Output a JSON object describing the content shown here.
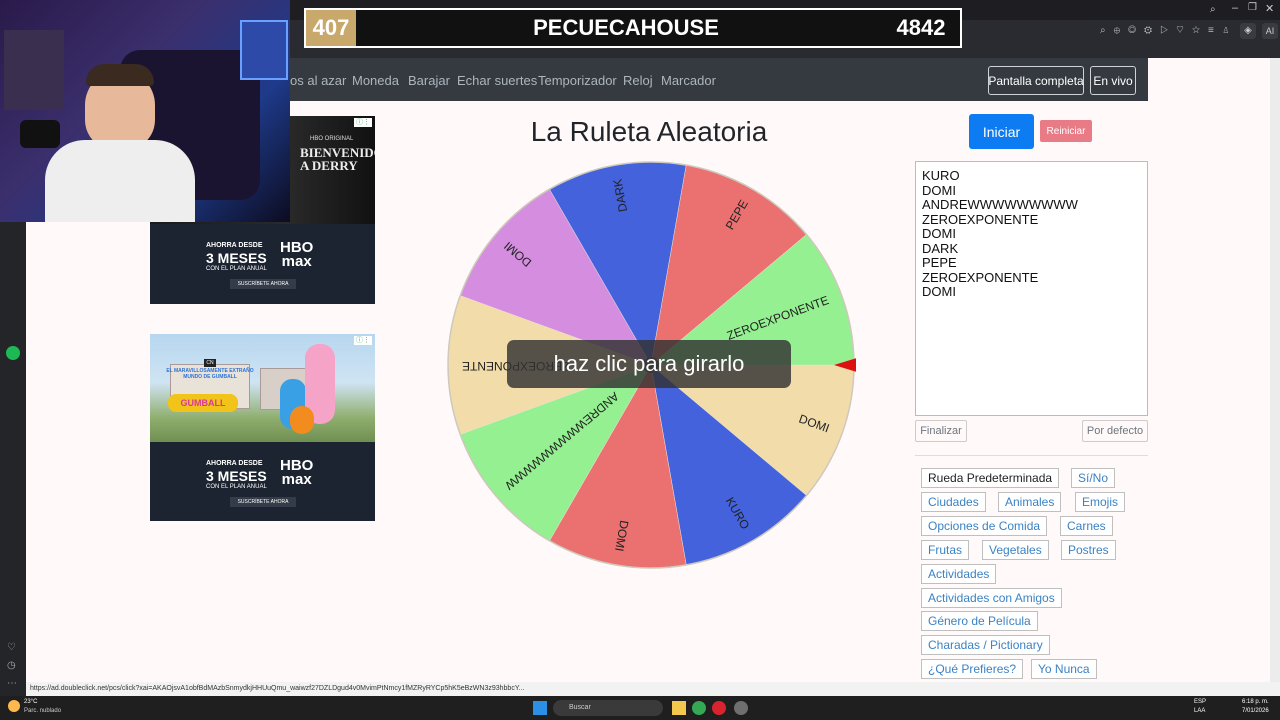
{
  "browser": {
    "status_url": "https://ad.doubleclick.net/pcs/click?xai=AKAOjsvA1obfBdMAzbSnmydkjHHUuQmu_waiwzf27DZLDgud4v0MvimPtNmcy1fMZRyRYCp5hK5eBzWN3z93hbbcY..."
  },
  "scoreboard": {
    "left": "407",
    "name": "PECUECAHOUSE",
    "right": "4842"
  },
  "nav": {
    "links": [
      "os al azar",
      "Moneda",
      "Barajar",
      "Echar suertes",
      "Temporizador",
      "Reloj",
      "Marcador"
    ],
    "fullscreen": "Pantalla completa",
    "live": "En vivo"
  },
  "main": {
    "title": "La Ruleta Aleatoria",
    "start": "Iniciar",
    "reset": "Reiniciar",
    "overlay": "haz clic para girarlo",
    "names": [
      "KURO",
      "DOMI",
      "ANDREWWWWWWWWW",
      "ZEROEXPONENTE",
      "DOMI",
      "DARK",
      "PEPE",
      "ZEROEXPONENTE",
      "DOMI"
    ],
    "finish": "Finalizar",
    "default": "Por defecto"
  },
  "wheel": {
    "segments": [
      {
        "label": "DOMI",
        "color": "#f1dcaa"
      },
      {
        "label": "KURO",
        "color": "#4462dc"
      },
      {
        "label": "DOMI",
        "color": "#eb7070"
      },
      {
        "label": "ANDREWWWWWWWWW",
        "color": "#94f090"
      },
      {
        "label": "ZEROEXPONENTE",
        "color": "#f1dcaa"
      },
      {
        "label": "DOMI",
        "color": "#d48ddf"
      },
      {
        "label": "DARK",
        "color": "#4462dc"
      },
      {
        "label": "PEPE",
        "color": "#eb7070"
      },
      {
        "label": "ZEROEXPONENTE",
        "color": "#94f090"
      }
    ],
    "pointer_color": "#dd1010"
  },
  "presets": [
    {
      "label": "Rueda Predeterminada"
    },
    {
      "label": "Sí/No"
    },
    {
      "label": "Ciudades"
    },
    {
      "label": "Animales"
    },
    {
      "label": "Emojis"
    },
    {
      "label": "Opciones de Comida"
    },
    {
      "label": "Carnes"
    },
    {
      "label": "Frutas"
    },
    {
      "label": "Vegetales"
    },
    {
      "label": "Postres"
    },
    {
      "label": "Actividades"
    },
    {
      "label": "Actividades con Amigos"
    },
    {
      "label": "Género de Película"
    },
    {
      "label": "Charadas / Pictionary"
    },
    {
      "label": "¿Qué Prefieres?"
    },
    {
      "label": "Yo Nunca"
    }
  ],
  "ads": {
    "ad1": {
      "brand": "HBO ORIGINAL",
      "headline": "BIENVENIDOS A DERRY",
      "offer_small": "AHORRA DESDE",
      "offer_big": "3 MESES",
      "offer_plan": "CON EL PLAN ANUAL",
      "logo_top": "HBO",
      "logo_bottom": "max",
      "cta": "SUSCRÍBETE AHORA"
    },
    "ad2": {
      "brand": "CN",
      "headline": "EL MARAVILLOSAMENTE EXTRAÑO MUNDO DE GUMBALL",
      "offer_small": "AHORRA DESDE",
      "offer_big": "3 MESES",
      "offer_plan": "CON EL PLAN ANUAL",
      "logo_top": "HBO",
      "logo_bottom": "max",
      "cta": "SUSCRÍBETE AHORA"
    }
  },
  "taskbar": {
    "weather_temp": "23°C",
    "weather_desc": "Parc. nublado",
    "search": "Buscar",
    "lang_top": "ESP",
    "lang_bottom": "LAA",
    "time": "6:18 p. m.",
    "date": "7/01/2026"
  }
}
